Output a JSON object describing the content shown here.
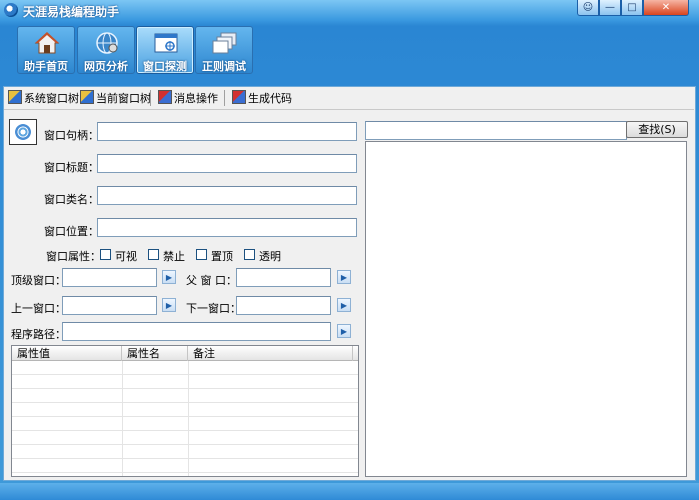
{
  "window": {
    "title": "天涯易栈编程助手",
    "caption_buttons": [
      "☺",
      "—",
      "□",
      "✕"
    ]
  },
  "toolbar": {
    "buttons": [
      {
        "label": "助手首页",
        "icon": "house-icon"
      },
      {
        "label": "网页分析",
        "icon": "globe-icon"
      },
      {
        "label": "窗口探测",
        "icon": "window-probe-icon",
        "active": true
      },
      {
        "label": "正则调试",
        "icon": "windows-stack-icon"
      }
    ]
  },
  "subbar": {
    "items": [
      {
        "label": "系统窗口树"
      },
      {
        "label": "当前窗口树"
      },
      {
        "label": "消息操作"
      },
      {
        "label": "生成代码"
      }
    ]
  },
  "form": {
    "handle_label": "窗口句柄：",
    "title_label": "窗口标题：",
    "class_label": "窗口类名：",
    "position_label": "窗口位置：",
    "attr_label": "窗口属性：",
    "attrs": [
      "可视",
      "禁止",
      "置顶",
      "透明"
    ],
    "top_label": "顶级窗口：",
    "parent_label": "父 窗 口：",
    "prev_label": "上一窗口：",
    "next_label": "下一窗口：",
    "path_label": "程序路径："
  },
  "grid": {
    "columns": [
      "属性值",
      "属性名",
      "备注"
    ]
  },
  "right": {
    "find_label": "查找(S)"
  }
}
